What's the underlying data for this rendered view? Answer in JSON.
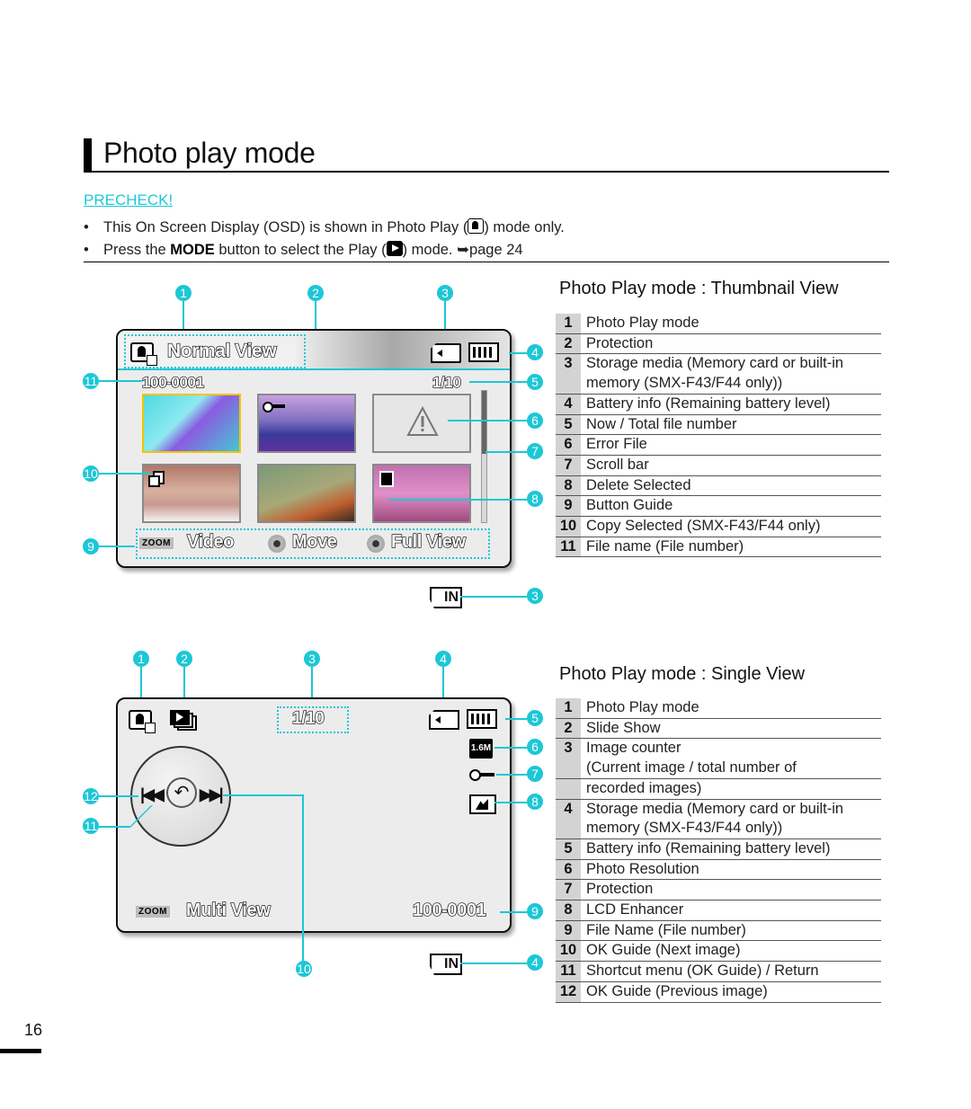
{
  "header": {
    "title": "Photo play mode",
    "precheck_label": "PRECHECK!",
    "bullets": [
      {
        "before": "This On Screen Display (OSD) is shown in Photo Play (",
        "icon": "photo-play-icon",
        "after": ") mode only."
      },
      {
        "before": "Press the ",
        "bold": "MODE",
        "middle": " button to select the Play (",
        "icon": "play-icon",
        "after": ") mode. ",
        "ref_arrow": "➥",
        "ref": "page 24"
      }
    ]
  },
  "thumbnail_view": {
    "mode_label": "Normal View",
    "file_name": "100-0001",
    "counter": "1/10",
    "guide": {
      "zoom_tag": "ZOOM",
      "zoom_label": "Video",
      "move_label": "Move",
      "ok_label": "Full View"
    },
    "storage_internal_label": "IN",
    "callouts": [
      "1",
      "2",
      "3",
      "4",
      "5",
      "6",
      "7",
      "8",
      "9",
      "10",
      "11",
      "3"
    ],
    "section_title": "Photo Play mode : Thumbnail View",
    "legend": [
      {
        "num": "1",
        "lines": [
          "Photo Play mode"
        ]
      },
      {
        "num": "2",
        "lines": [
          "Protection"
        ]
      },
      {
        "num": "3",
        "lines": [
          "Storage media (Memory card or built-in",
          "memory (SMX-F43/F44 only))"
        ]
      },
      {
        "num": "4",
        "lines": [
          "Battery info (Remaining battery level)"
        ]
      },
      {
        "num": "5",
        "lines": [
          "Now / Total file number"
        ]
      },
      {
        "num": "6",
        "lines": [
          "Error File"
        ]
      },
      {
        "num": "7",
        "lines": [
          "Scroll bar"
        ]
      },
      {
        "num": "8",
        "lines": [
          "Delete Selected"
        ]
      },
      {
        "num": "9",
        "lines": [
          "Button Guide"
        ]
      },
      {
        "num": "10",
        "lines": [
          "Copy Selected (SMX-F43/F44 only)"
        ]
      },
      {
        "num": "11",
        "lines": [
          "File name (File number)"
        ]
      }
    ]
  },
  "single_view": {
    "counter": "1/10",
    "resolution": "1.6M",
    "guide": {
      "zoom_tag": "ZOOM",
      "zoom_label": "Multi View"
    },
    "file_name": "100-0001",
    "storage_internal_label": "IN",
    "callouts": [
      "1",
      "2",
      "3",
      "4",
      "5",
      "6",
      "7",
      "8",
      "9",
      "10",
      "11",
      "12",
      "4"
    ],
    "section_title": "Photo Play mode : Single View",
    "legend": [
      {
        "num": "1",
        "lines": [
          "Photo Play mode"
        ]
      },
      {
        "num": "2",
        "lines": [
          "Slide Show"
        ]
      },
      {
        "num": "3",
        "lines": [
          "Image counter",
          "(Current image / total number of"
        ]
      },
      {
        "num": "",
        "lines": [
          "recorded images)"
        ]
      },
      {
        "num": "4",
        "lines": [
          "Storage media (Memory card or built-in",
          "memory (SMX-F43/F44 only))"
        ]
      },
      {
        "num": "5",
        "lines": [
          "Battery info (Remaining battery level)"
        ]
      },
      {
        "num": "6",
        "lines": [
          "Photo Resolution"
        ]
      },
      {
        "num": "7",
        "lines": [
          "Protection"
        ]
      },
      {
        "num": "8",
        "lines": [
          "LCD Enhancer"
        ]
      },
      {
        "num": "9",
        "lines": [
          "File Name (File number)"
        ]
      },
      {
        "num": "10",
        "lines": [
          "OK Guide (Next image)"
        ]
      },
      {
        "num": "11",
        "lines": [
          "Shortcut menu (OK Guide) / Return"
        ]
      },
      {
        "num": "12",
        "lines": [
          "OK Guide (Previous image)"
        ]
      }
    ]
  },
  "footer": {
    "page_number": "16"
  },
  "colors": {
    "accent": "#1cc7d6",
    "selection": "#f5c400",
    "lcd_bg": "#ececec",
    "legend_num_bg": "#d3d3d3"
  }
}
